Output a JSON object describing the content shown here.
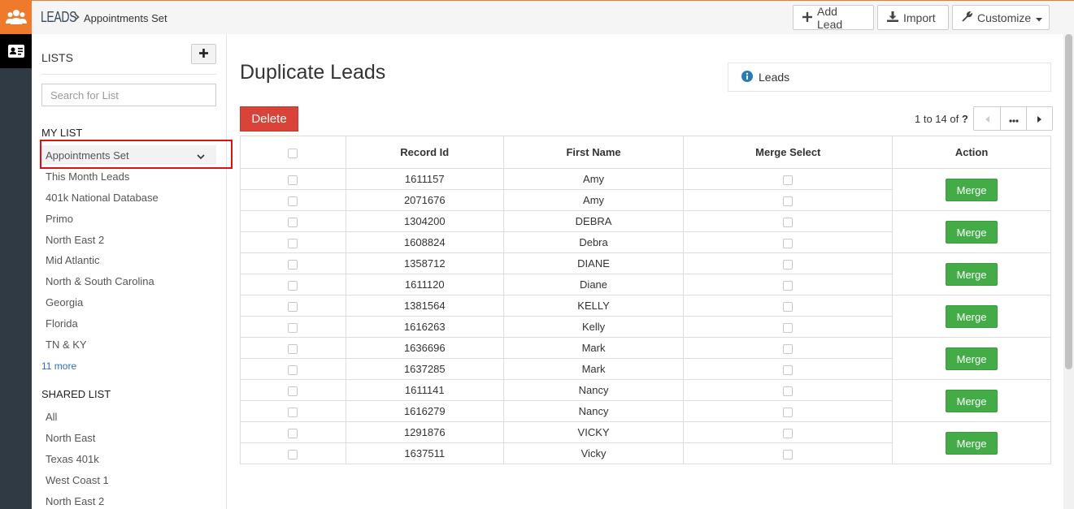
{
  "header": {
    "brand": "LEADS",
    "breadcrumb": "Appointments Set",
    "buttons": {
      "add_lead": "Add Lead",
      "import": "Import",
      "customize": "Customize"
    }
  },
  "sidebar": {
    "title": "LISTS",
    "search_placeholder": "Search for List",
    "my_list_heading": "MY LIST",
    "selected": "Appointments Set",
    "my_list": [
      "This Month Leads",
      "401k National Database",
      "Primo",
      "North East 2",
      "Mid Atlantic",
      "North & South Carolina",
      "Georgia",
      "Florida",
      "TN & KY"
    ],
    "more_link": "11 more",
    "shared_list_heading": "SHARED LIST",
    "shared_list": [
      "All",
      "North East",
      "Texas 401k",
      "West Coast 1",
      "North East 2"
    ]
  },
  "main": {
    "title": "Duplicate Leads",
    "info_label": "Leads",
    "delete_label": "Delete",
    "pager": {
      "range": "1 to 14",
      "of": "of",
      "total": "?"
    },
    "columns": [
      "Record Id",
      "First Name",
      "Merge Select",
      "Action"
    ],
    "merge_label": "Merge",
    "rows": [
      {
        "id": "1611157",
        "name": "Amy"
      },
      {
        "id": "2071676",
        "name": "Amy"
      },
      {
        "id": "1304200",
        "name": "DEBRA"
      },
      {
        "id": "1608824",
        "name": "Debra"
      },
      {
        "id": "1358712",
        "name": "DIANE"
      },
      {
        "id": "1611120",
        "name": "Diane"
      },
      {
        "id": "1381564",
        "name": "KELLY"
      },
      {
        "id": "1616263",
        "name": "Kelly"
      },
      {
        "id": "1636696",
        "name": "Mark"
      },
      {
        "id": "1637285",
        "name": "Mark"
      },
      {
        "id": "1611141",
        "name": "Nancy"
      },
      {
        "id": "1616279",
        "name": "Nancy"
      },
      {
        "id": "1291876",
        "name": "VICKY"
      },
      {
        "id": "1637511",
        "name": "Vicky"
      }
    ]
  },
  "colors": {
    "accent": "#f07a2c",
    "danger": "#d9433a",
    "success": "#43ac47",
    "link": "#2a6ebb",
    "info_icon": "#2a7ab8"
  }
}
